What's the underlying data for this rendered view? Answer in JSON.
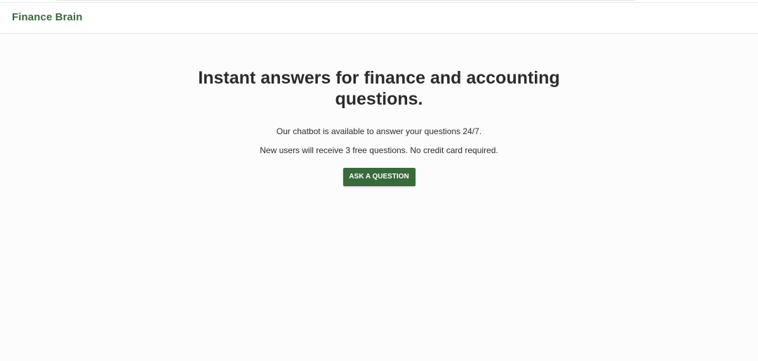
{
  "header": {
    "brand": "Finance Brain"
  },
  "hero": {
    "title": "Instant answers for finance and accounting questions.",
    "line1": "Our chatbot is available to answer your questions 24/7.",
    "line2": "New users will receive 3 free questions. No credit card required.",
    "cta_label": "ASK A QUESTION"
  },
  "colors": {
    "brand_green": "#356a3a",
    "button_green": "#386a3c",
    "heading": "#2d2a2a",
    "background": "#fdfcfc"
  }
}
